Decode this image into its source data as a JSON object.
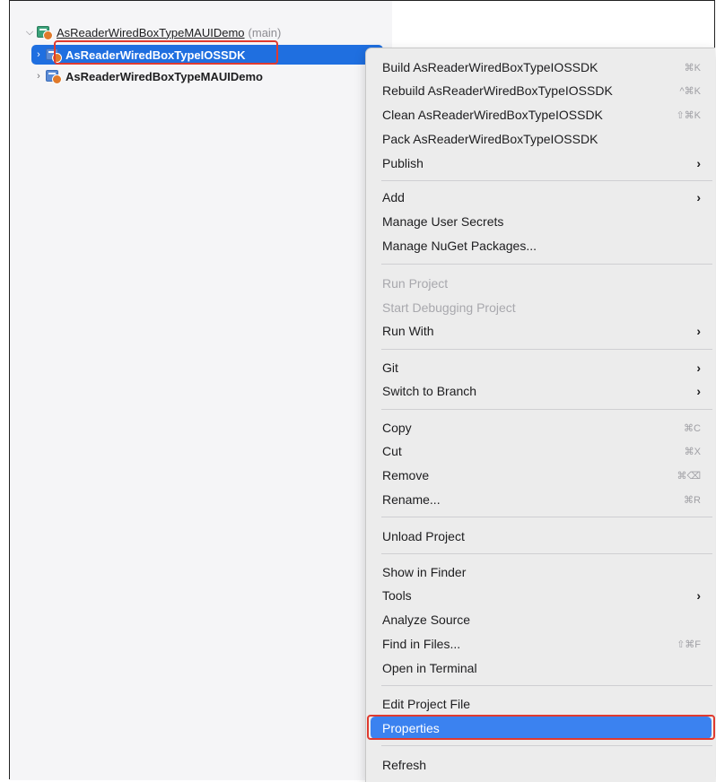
{
  "solution": {
    "name": "AsReaderWiredBoxTypeMAUIDemo",
    "branch": "(main)"
  },
  "projects": [
    {
      "name": "AsReaderWiredBoxTypeIOSSDK",
      "selected": true
    },
    {
      "name": "AsReaderWiredBoxTypeMAUIDemo",
      "selected": false
    }
  ],
  "menu": {
    "build": {
      "label": "Build AsReaderWiredBoxTypeIOSSDK",
      "shortcut": "⌘K"
    },
    "rebuild": {
      "label": "Rebuild AsReaderWiredBoxTypeIOSSDK",
      "shortcut": "^⌘K"
    },
    "clean": {
      "label": "Clean AsReaderWiredBoxTypeIOSSDK",
      "shortcut": "⇧⌘K"
    },
    "pack": {
      "label": "Pack AsReaderWiredBoxTypeIOSSDK"
    },
    "publish": {
      "label": "Publish",
      "arrow": "›"
    },
    "add": {
      "label": "Add",
      "arrow": "›"
    },
    "manage_secrets": {
      "label": "Manage User Secrets"
    },
    "manage_nuget": {
      "label": "Manage NuGet Packages..."
    },
    "run_project": {
      "label": "Run Project"
    },
    "start_debugging": {
      "label": "Start Debugging Project"
    },
    "run_with": {
      "label": "Run With",
      "arrow": "›"
    },
    "git": {
      "label": "Git",
      "arrow": "›"
    },
    "switch_branch": {
      "label": "Switch to Branch",
      "arrow": "›"
    },
    "copy": {
      "label": "Copy",
      "shortcut": "⌘C"
    },
    "cut": {
      "label": "Cut",
      "shortcut": "⌘X"
    },
    "remove": {
      "label": "Remove",
      "shortcut": "⌘⌫"
    },
    "rename": {
      "label": "Rename...",
      "shortcut": "⌘R"
    },
    "unload": {
      "label": "Unload Project"
    },
    "show_finder": {
      "label": "Show in Finder"
    },
    "tools": {
      "label": "Tools",
      "arrow": "›"
    },
    "analyze": {
      "label": "Analyze Source"
    },
    "find_files": {
      "label": "Find in Files...",
      "shortcut": "⇧⌘F"
    },
    "open_terminal": {
      "label": "Open in Terminal"
    },
    "edit_project": {
      "label": "Edit Project File"
    },
    "properties": {
      "label": "Properties"
    },
    "refresh": {
      "label": "Refresh"
    }
  },
  "colors": {
    "selection": "#1f6fe0",
    "highlight": "#3b82f0",
    "annotation": "#e03a2f"
  }
}
